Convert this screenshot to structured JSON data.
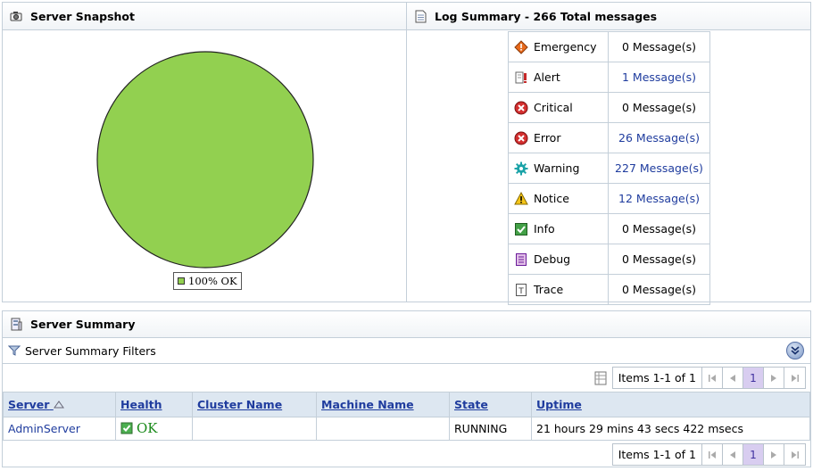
{
  "snapshot": {
    "title": "Server Snapshot",
    "legend": "100% OK",
    "pie_color": "#92d050"
  },
  "chart_data": {
    "type": "pie",
    "categories": [
      "OK"
    ],
    "values": [
      100
    ]
  },
  "log_summary": {
    "title": "Log Summary - 266 Total messages",
    "rows": [
      {
        "level": "Emergency",
        "count": "0 Message(s)",
        "link": false,
        "icon": "emergency-icon"
      },
      {
        "level": "Alert",
        "count": "1 Message(s)",
        "link": true,
        "icon": "alert-icon"
      },
      {
        "level": "Critical",
        "count": "0 Message(s)",
        "link": false,
        "icon": "critical-icon"
      },
      {
        "level": "Error",
        "count": "26 Message(s)",
        "link": true,
        "icon": "error-icon"
      },
      {
        "level": "Warning",
        "count": "227 Message(s)",
        "link": true,
        "icon": "warning-icon"
      },
      {
        "level": "Notice",
        "count": "12 Message(s)",
        "link": true,
        "icon": "notice-icon"
      },
      {
        "level": "Info",
        "count": "0 Message(s)",
        "link": false,
        "icon": "info-icon"
      },
      {
        "level": "Debug",
        "count": "0 Message(s)",
        "link": false,
        "icon": "debug-icon"
      },
      {
        "level": "Trace",
        "count": "0 Message(s)",
        "link": false,
        "icon": "trace-icon"
      }
    ]
  },
  "server_summary": {
    "title": "Server Summary",
    "filters_label": "Server Summary Filters",
    "pager": {
      "items": "Items 1-1 of 1",
      "page": "1"
    },
    "columns": [
      "Server",
      "Health",
      "Cluster Name",
      "Machine Name",
      "State",
      "Uptime"
    ],
    "rows": [
      {
        "server": "AdminServer",
        "health": "OK",
        "cluster": "",
        "machine": "",
        "state": "RUNNING",
        "uptime": "21 hours 29 mins 43 secs 422 msecs"
      }
    ]
  }
}
